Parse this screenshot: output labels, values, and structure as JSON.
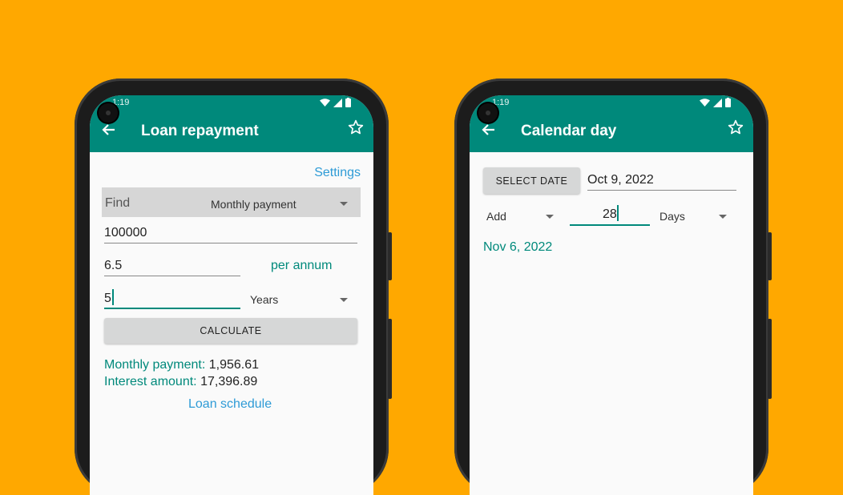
{
  "left": {
    "status_time": "1:19",
    "title": "Loan repayment",
    "settings_link": "Settings",
    "find_label": "Find",
    "find_select": "Monthly payment",
    "amount_value": "100000",
    "rate_value": "6.5",
    "rate_unit": "per annum",
    "term_value": "5",
    "term_unit_select": "Years",
    "calculate_button": "CALCULATE",
    "monthly_payment_label": "Monthly payment:",
    "monthly_payment_value": "1,956.61",
    "interest_label": "Interest amount:",
    "interest_value": "17,396.89",
    "schedule_link": "Loan schedule"
  },
  "right": {
    "status_time": "1:19",
    "title": "Calendar day",
    "select_date_button": "SELECT DATE",
    "date_value": "Oct 9, 2022",
    "operation_select": "Add",
    "amount_value": "28",
    "unit_select": "Days",
    "result_date": "Nov 6, 2022"
  },
  "icons": {
    "back": "arrow-left",
    "favorite": "star-outline",
    "wifi": "wifi",
    "signal": "cell-signal",
    "battery": "battery"
  },
  "colors": {
    "background": "#FFA800",
    "primary": "#00897B",
    "link": "#2E9BD6",
    "button": "#D6D7D7"
  }
}
